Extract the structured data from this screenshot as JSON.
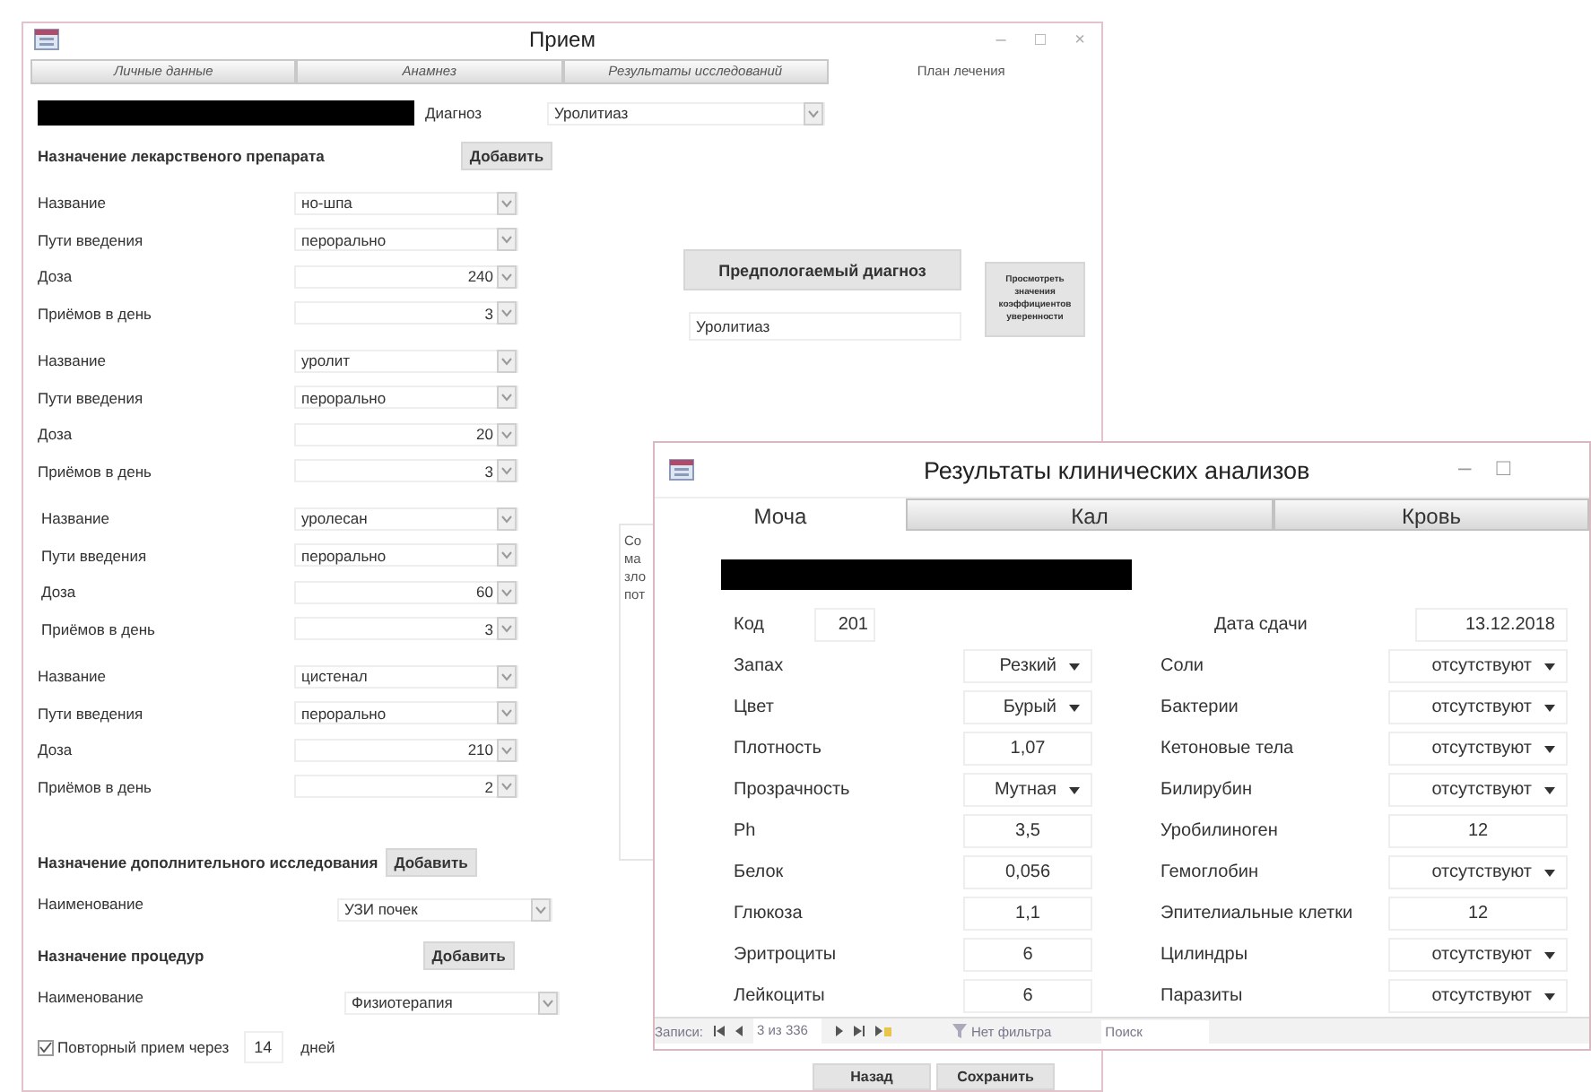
{
  "reception_window": {
    "title": "Прием",
    "controls": [
      "–",
      "□",
      "×"
    ],
    "tabs": [
      {
        "label": "Личные данные",
        "selected": false
      },
      {
        "label": "Анамнез",
        "selected": false
      },
      {
        "label": "Результаты исследований",
        "selected": false
      },
      {
        "label": "План лечения",
        "selected": true
      }
    ],
    "diagnosis": {
      "label": "Диагноз",
      "value": "Уролитиаз"
    },
    "drug_section": {
      "title": "Назначение лекарственого препарата",
      "button": "Добавить"
    },
    "drugs": [
      {
        "name_label": "Название",
        "name": "но-шпа",
        "route_label": "Пути введения",
        "route": "перорально",
        "dose_label": "Доза",
        "dose": "240",
        "times_label": "Приёмов в день",
        "times": "3"
      },
      {
        "name_label": "Название",
        "name": "уролит",
        "route_label": "Пути введения",
        "route": "перорально",
        "dose_label": "Доза",
        "dose": "20",
        "times_label": "Приёмов в день",
        "times": "3"
      },
      {
        "name_label": "Название",
        "name": "уролесан",
        "route_label": "Пути введения",
        "route": "перорально",
        "dose_label": "Доза",
        "dose": "60",
        "times_label": "Приёмов в день",
        "times": "3"
      },
      {
        "name_label": "Название",
        "name": "цистенал",
        "route_label": "Пути введения",
        "route": "перорально",
        "dose_label": "Доза",
        "dose": "210",
        "times_label": "Приёмов в день",
        "times": "2"
      }
    ],
    "predicted_diagnosis": {
      "button": "Предпологаемый диагноз",
      "value": "Уролитиаз"
    },
    "confidence_button": "Просмотреть значения коэффициентов уверенности",
    "notes_lines": [
      "Со",
      "ма",
      "зло",
      "пот"
    ],
    "exam_section": {
      "title": "Назначение дополнительного исследования",
      "button": "Добавить",
      "label": "Наименование",
      "value": "УЗИ почек"
    },
    "procedure_section": {
      "title": "Назначение процедур",
      "button": "Добавить",
      "label": "Наименование",
      "value": "Физиотерапия"
    },
    "follow_up": {
      "checked": true,
      "label": "Повторный прием через",
      "value": "14",
      "unit": "дней"
    },
    "buttons": [
      "Назад",
      "Сохранить"
    ]
  },
  "results_window": {
    "title": "Результаты клинических анализов",
    "controls": [
      "–",
      "□"
    ],
    "tabs": [
      {
        "label": "Моча",
        "selected": true
      },
      {
        "label": "Кал",
        "selected": false
      },
      {
        "label": "Кровь",
        "selected": false
      }
    ],
    "code": {
      "label": "Код",
      "value": "201"
    },
    "date": {
      "label": "Дата сдачи",
      "value": "13.12.2018"
    },
    "rows": [
      {
        "left": {
          "label": "Запах",
          "value": "Резкий",
          "kind": "combo"
        },
        "right": {
          "label": "Соли",
          "value": "отсутствуют",
          "kind": "combo"
        }
      },
      {
        "left": {
          "label": "Цвет",
          "value": "Бурый",
          "kind": "combo"
        },
        "right": {
          "label": "Бактерии",
          "value": "отсутствуют",
          "kind": "combo"
        }
      },
      {
        "left": {
          "label": "Плотность",
          "value": "1,07",
          "kind": "text"
        },
        "right": {
          "label": "Кетоновые тела",
          "value": "отсутствуют",
          "kind": "combo"
        }
      },
      {
        "left": {
          "label": "Прозрачность",
          "value": "Мутная",
          "kind": "combo"
        },
        "right": {
          "label": "Билирубин",
          "value": "отсутствуют",
          "kind": "combo"
        }
      },
      {
        "left": {
          "label": "Ph",
          "value": "3,5",
          "kind": "text"
        },
        "right": {
          "label": "Уробилиноген",
          "value": "12",
          "kind": "text"
        }
      },
      {
        "left": {
          "label": "Белок",
          "value": "0,056",
          "kind": "text"
        },
        "right": {
          "label": "Гемоглобин",
          "value": "отсутствуют",
          "kind": "combo"
        }
      },
      {
        "left": {
          "label": "Глюкоза",
          "value": "1,1",
          "kind": "text"
        },
        "right": {
          "label": "Эпителиальные клетки",
          "value": "12",
          "kind": "text"
        }
      },
      {
        "left": {
          "label": "Эритроциты",
          "value": "6",
          "kind": "text"
        },
        "right": {
          "label": "Цилиндры",
          "value": "отсутствуют",
          "kind": "combo"
        }
      },
      {
        "left": {
          "label": "Лейкоциты",
          "value": "6",
          "kind": "text"
        },
        "right": {
          "label": "Паразиты",
          "value": "отсутствуют",
          "kind": "combo"
        }
      }
    ],
    "navigator": {
      "label": "Записи:",
      "position": "3 из 336",
      "filter": "Нет фильтра",
      "search": "Поиск"
    }
  }
}
